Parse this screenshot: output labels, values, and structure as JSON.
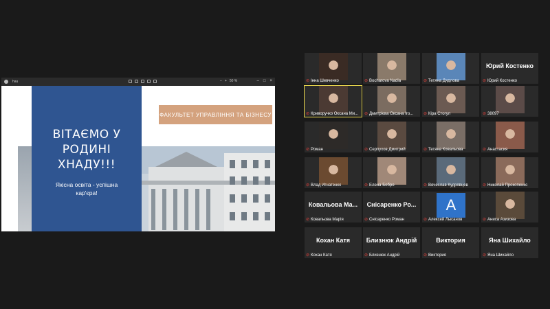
{
  "share": {
    "file_name": "hau",
    "zoom": "50 %",
    "slide": {
      "heading_lines": [
        "ВІТАЄМО У",
        "РОДИНІ",
        "ХНАДУ!!!"
      ],
      "subtitle_lines": [
        "Якісна освіта - успішна",
        "кар'єра!"
      ],
      "badge": "ФАКУЛЬТЕТ УПРАВЛІННЯ ТА БІЗНЕСУ"
    }
  },
  "gallery": {
    "mic_icon": "muted-mic-icon",
    "colors": {
      "muted": "#e0403a",
      "active_speaker": "#e5d34c",
      "avatar_bg": "#2f73c9"
    },
    "tiles": [
      {
        "caption": "Інна Шевченко",
        "big_name": "",
        "photo": "#3a2b24"
      },
      {
        "caption": "Bocharova Nadia",
        "big_name": "",
        "photo": "#8a7a6a"
      },
      {
        "caption": "Тетяна Дядлова",
        "big_name": "",
        "photo": "#5a86b8"
      },
      {
        "caption": "Юрий Костенко",
        "big_name": "Юрий Костенко",
        "photo": ""
      },
      {
        "caption": "Криворучко Оксана Ми...",
        "big_name": "",
        "photo": "#4b3a33"
      },
      {
        "caption": "Дмитрієва Оксана Іго...",
        "big_name": "",
        "photo": "#7b6c60"
      },
      {
        "caption": "Кіра Стогул",
        "big_name": "",
        "photo": "#6b5a52"
      },
      {
        "caption": "38097",
        "big_name": "",
        "photo": "#5b4b48"
      },
      {
        "caption": "Роман",
        "big_name": "",
        "photo": "#2d2a28"
      },
      {
        "caption": "Серпухов Дмитрий",
        "big_name": "",
        "photo": "#5a4a40"
      },
      {
        "caption": "Тетяна Ковальова",
        "big_name": "",
        "photo": "#7a6e66"
      },
      {
        "caption": "Анастасия",
        "big_name": "",
        "photo": "#8a5a4a"
      },
      {
        "caption": "Влад Игнатенко",
        "big_name": "",
        "photo": "#6b4a30"
      },
      {
        "caption": "Елена Бобро",
        "big_name": "",
        "photo": "#a08878"
      },
      {
        "caption": "Вячеслав Кудрявцев",
        "big_name": "",
        "photo": "#5a6a7a"
      },
      {
        "caption": "Николай Прокопенко",
        "big_name": "",
        "photo": "#8a6a5a"
      },
      {
        "caption": "Ковальова Марія",
        "big_name": "Ковальова Ма...",
        "photo": ""
      },
      {
        "caption": "Снісаренко Роман",
        "big_name": "Снісаренко Ро...",
        "photo": ""
      },
      {
        "caption": "Алексей Лысанов",
        "big_name": "",
        "photo": "",
        "avatar": "A"
      },
      {
        "caption": "Аниса Азизова",
        "big_name": "",
        "photo": "#5a4a3a"
      },
      {
        "caption": "Кохан Катя",
        "big_name": "Кохан Катя",
        "photo": ""
      },
      {
        "caption": "Близнюк Андрій",
        "big_name": "Близнюк Андрій",
        "photo": ""
      },
      {
        "caption": "Виктория",
        "big_name": "Виктория",
        "photo": ""
      },
      {
        "caption": "Яна Шихайло",
        "big_name": "Яна Шихайло",
        "photo": ""
      }
    ]
  }
}
